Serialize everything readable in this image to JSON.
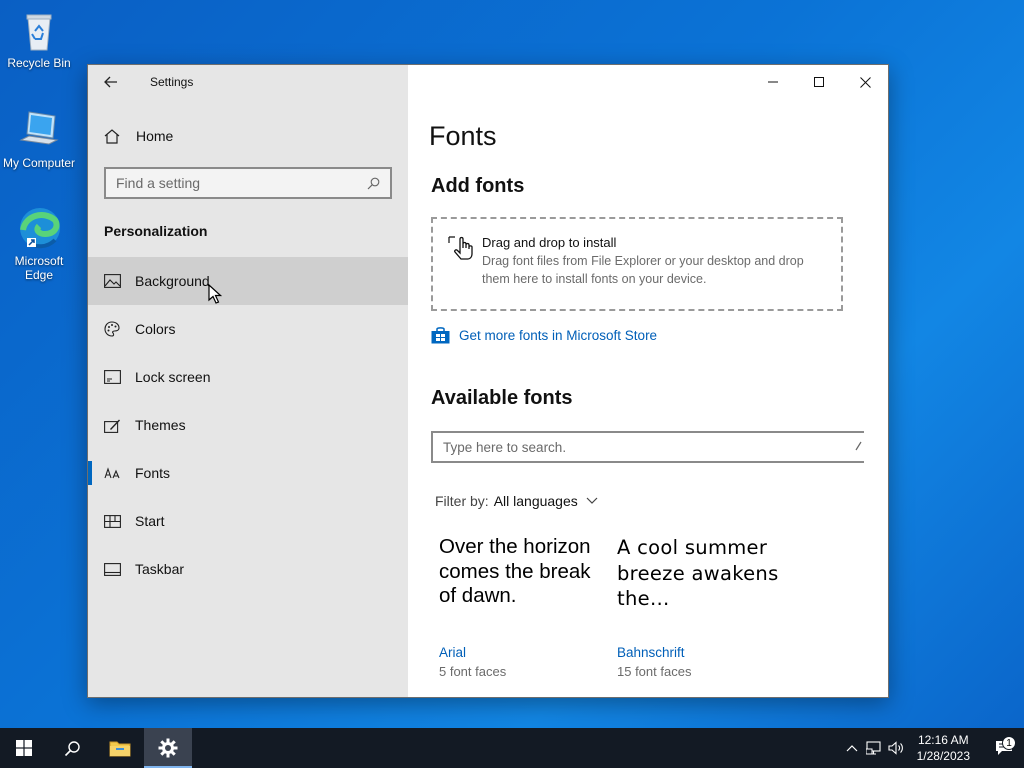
{
  "desktop": {
    "icons": [
      {
        "label": "Recycle Bin"
      },
      {
        "label": "My Computer"
      },
      {
        "label": "Microsoft Edge"
      }
    ]
  },
  "window": {
    "app_title": "Settings",
    "sidebar": {
      "home_label": "Home",
      "search_placeholder": "Find a setting",
      "section_title": "Personalization",
      "items": [
        {
          "label": "Background",
          "icon": "picture-icon"
        },
        {
          "label": "Colors",
          "icon": "palette-icon"
        },
        {
          "label": "Lock screen",
          "icon": "lock-screen-icon"
        },
        {
          "label": "Themes",
          "icon": "themes-brush-icon"
        },
        {
          "label": "Fonts",
          "icon": "fonts-icon"
        },
        {
          "label": "Start",
          "icon": "start-tiles-icon"
        },
        {
          "label": "Taskbar",
          "icon": "taskbar-icon"
        }
      ],
      "active_item": "Fonts",
      "hovered_item": "Background"
    },
    "content": {
      "page_title": "Fonts",
      "add_fonts_heading": "Add fonts",
      "drop_title": "Drag and drop to install",
      "drop_description": "Drag font files from File Explorer or your desktop and drop them here to install fonts on your device.",
      "store_link": "Get more fonts in Microsoft Store",
      "available_heading": "Available fonts",
      "font_search_placeholder": "Type here to search.",
      "filter_label": "Filter by:",
      "filter_value": "All languages",
      "fonts": [
        {
          "sample": "Over the horizon comes the break of dawn.",
          "name": "Arial",
          "faces": "5 font faces"
        },
        {
          "sample": "A cool summer breeze awakens the…",
          "name": "Bahnschrift",
          "faces": "15 font faces"
        }
      ]
    }
  },
  "taskbar": {
    "time": "12:16 AM",
    "date": "1/28/2023",
    "notification_count": "1"
  },
  "colors": {
    "accent": "#0067c0",
    "link": "#005fb8",
    "sidebar_bg": "#e6e6e6",
    "taskbar_bg": "#131a24"
  }
}
